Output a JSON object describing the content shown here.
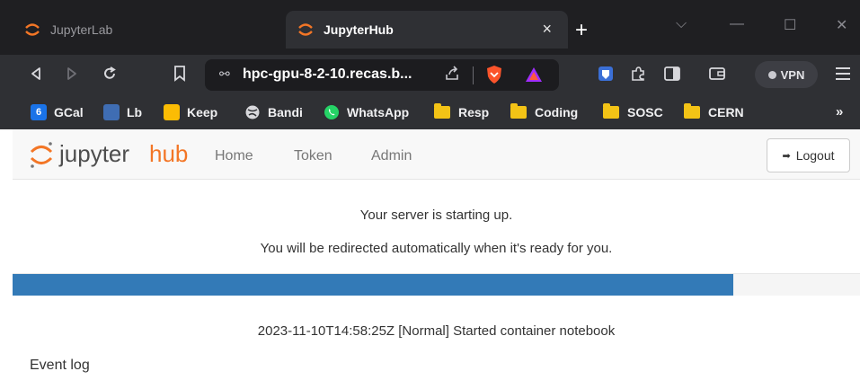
{
  "browser": {
    "tabs": [
      {
        "title": "JupyterLab",
        "active": false
      },
      {
        "title": "JupyterHub",
        "active": true
      }
    ],
    "tab_close": "×",
    "new_tab": "+",
    "window_controls": {
      "dropdown": "⌵",
      "minimize": "—",
      "maximize": "☐",
      "close": "✕"
    },
    "url": "hpc-gpu-8-2-10.recas.b...",
    "vpn_label": "VPN",
    "bookmarks": [
      {
        "label": "GCal",
        "icon": "calendar-icon"
      },
      {
        "label": "Lb",
        "icon": "lb-icon"
      },
      {
        "label": "Keep",
        "icon": "keep-icon"
      },
      {
        "label": "Bandi",
        "icon": "globe-icon"
      },
      {
        "label": "WhatsApp",
        "icon": "whatsapp-icon"
      },
      {
        "label": "Resp",
        "icon": "folder-icon"
      },
      {
        "label": "Coding",
        "icon": "folder-icon"
      },
      {
        "label": "SOSC",
        "icon": "folder-icon"
      },
      {
        "label": "CERN",
        "icon": "folder-icon"
      }
    ],
    "bookmarks_more": "»",
    "gcal_badge": "6"
  },
  "hub": {
    "logo_text_a": "jupyter",
    "logo_text_b": "hub",
    "nav": [
      {
        "label": "Home"
      },
      {
        "label": "Token"
      },
      {
        "label": "Admin"
      }
    ],
    "logout_label": "Logout",
    "starting_message": "Your server is starting up.",
    "redirect_message": "You will be redirected automatically when it's ready for you.",
    "progress_fraction": 0.85,
    "event_message": "2023-11-10T14:58:25Z [Normal] Started container notebook",
    "event_log_label": "Event log"
  },
  "colors": {
    "jupyter_orange": "#f37626",
    "progress_blue": "#337ab7",
    "brave_orange": "#fb542b",
    "whatsapp_green": "#25d366",
    "folder_yellow": "#f3c316"
  }
}
